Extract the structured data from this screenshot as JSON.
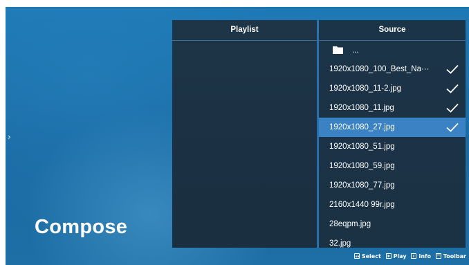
{
  "side_nav": {
    "arrow": "›"
  },
  "page": {
    "title": "Compose"
  },
  "playlist_panel": {
    "header": "Playlist"
  },
  "source_panel": {
    "header": "Source",
    "folder_label": "...",
    "items": [
      {
        "name": "1920x1080_100_Best_Na···",
        "checked": true,
        "selected": false
      },
      {
        "name": "1920x1080_11-2.jpg",
        "checked": true,
        "selected": false
      },
      {
        "name": "1920x1080_11.jpg",
        "checked": true,
        "selected": false
      },
      {
        "name": "1920x1080_27.jpg",
        "checked": true,
        "selected": true
      },
      {
        "name": "1920x1080_51.jpg",
        "checked": false,
        "selected": false
      },
      {
        "name": "1920x1080_59.jpg",
        "checked": false,
        "selected": false
      },
      {
        "name": "1920x1080_77.jpg",
        "checked": false,
        "selected": false
      },
      {
        "name": "2160x1440   99r.jpg",
        "checked": false,
        "selected": false
      },
      {
        "name": "28eqpm.jpg",
        "checked": false,
        "selected": false
      },
      {
        "name": "32.jpg",
        "checked": false,
        "selected": false
      }
    ]
  },
  "status_bar": {
    "select": "Select",
    "play": "Play",
    "info": "Info",
    "toolbar": "Toolbar"
  },
  "colors": {
    "selected_row": "#3a82c4",
    "panel_bg": "#1d3347",
    "background": "#1a6aa3"
  }
}
